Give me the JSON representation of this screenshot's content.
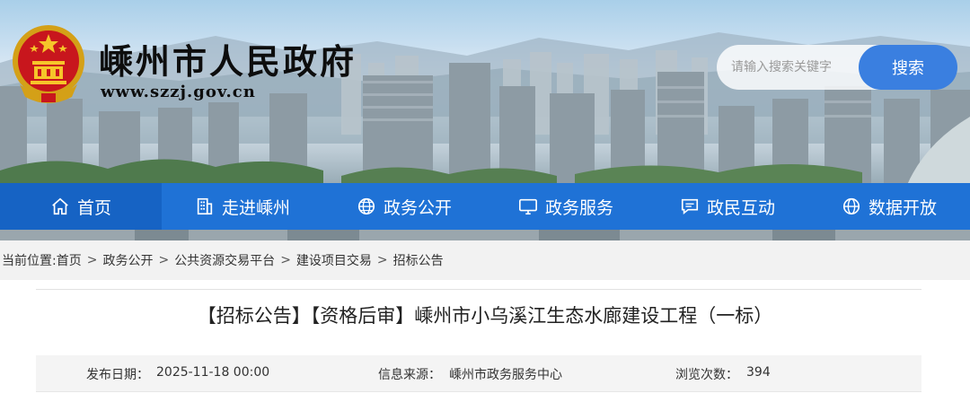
{
  "site": {
    "name": "嵊州市人民政府",
    "url": "www.szzj.gov.cn"
  },
  "search": {
    "placeholder": "请输入搜索关键字",
    "button_label": "搜索"
  },
  "nav": {
    "items": [
      {
        "label": "首页",
        "icon": "home-icon",
        "active": true
      },
      {
        "label": "走进嵊州",
        "icon": "building-icon"
      },
      {
        "label": "政务公开",
        "icon": "globe-icon"
      },
      {
        "label": "政务服务",
        "icon": "monitor-icon"
      },
      {
        "label": "政民互动",
        "icon": "chat-icon"
      },
      {
        "label": "数据开放",
        "icon": "globe-icon"
      }
    ]
  },
  "breadcrumb": {
    "prefix": "当前位置:",
    "items": [
      "首页",
      "政务公开",
      "公共资源交易平台",
      "建设项目交易",
      "招标公告"
    ],
    "separator": ">"
  },
  "article": {
    "title": "【招标公告】【资格后审】嵊州市小乌溪江生态水廊建设工程（一标）",
    "meta": {
      "date_label": "发布日期：",
      "date": "2025-11-18 00:00",
      "source_label": "信息来源：",
      "source": "嵊州市政务服务中心",
      "views_label": "浏览次数：",
      "views": "394"
    }
  },
  "colors": {
    "nav_bg": "#1f72d6",
    "nav_active": "#1663c4",
    "search_button": "#3a7fe0",
    "breadcrumb_bg": "#f2f2f2",
    "meta_bg": "#f4f4f4"
  }
}
